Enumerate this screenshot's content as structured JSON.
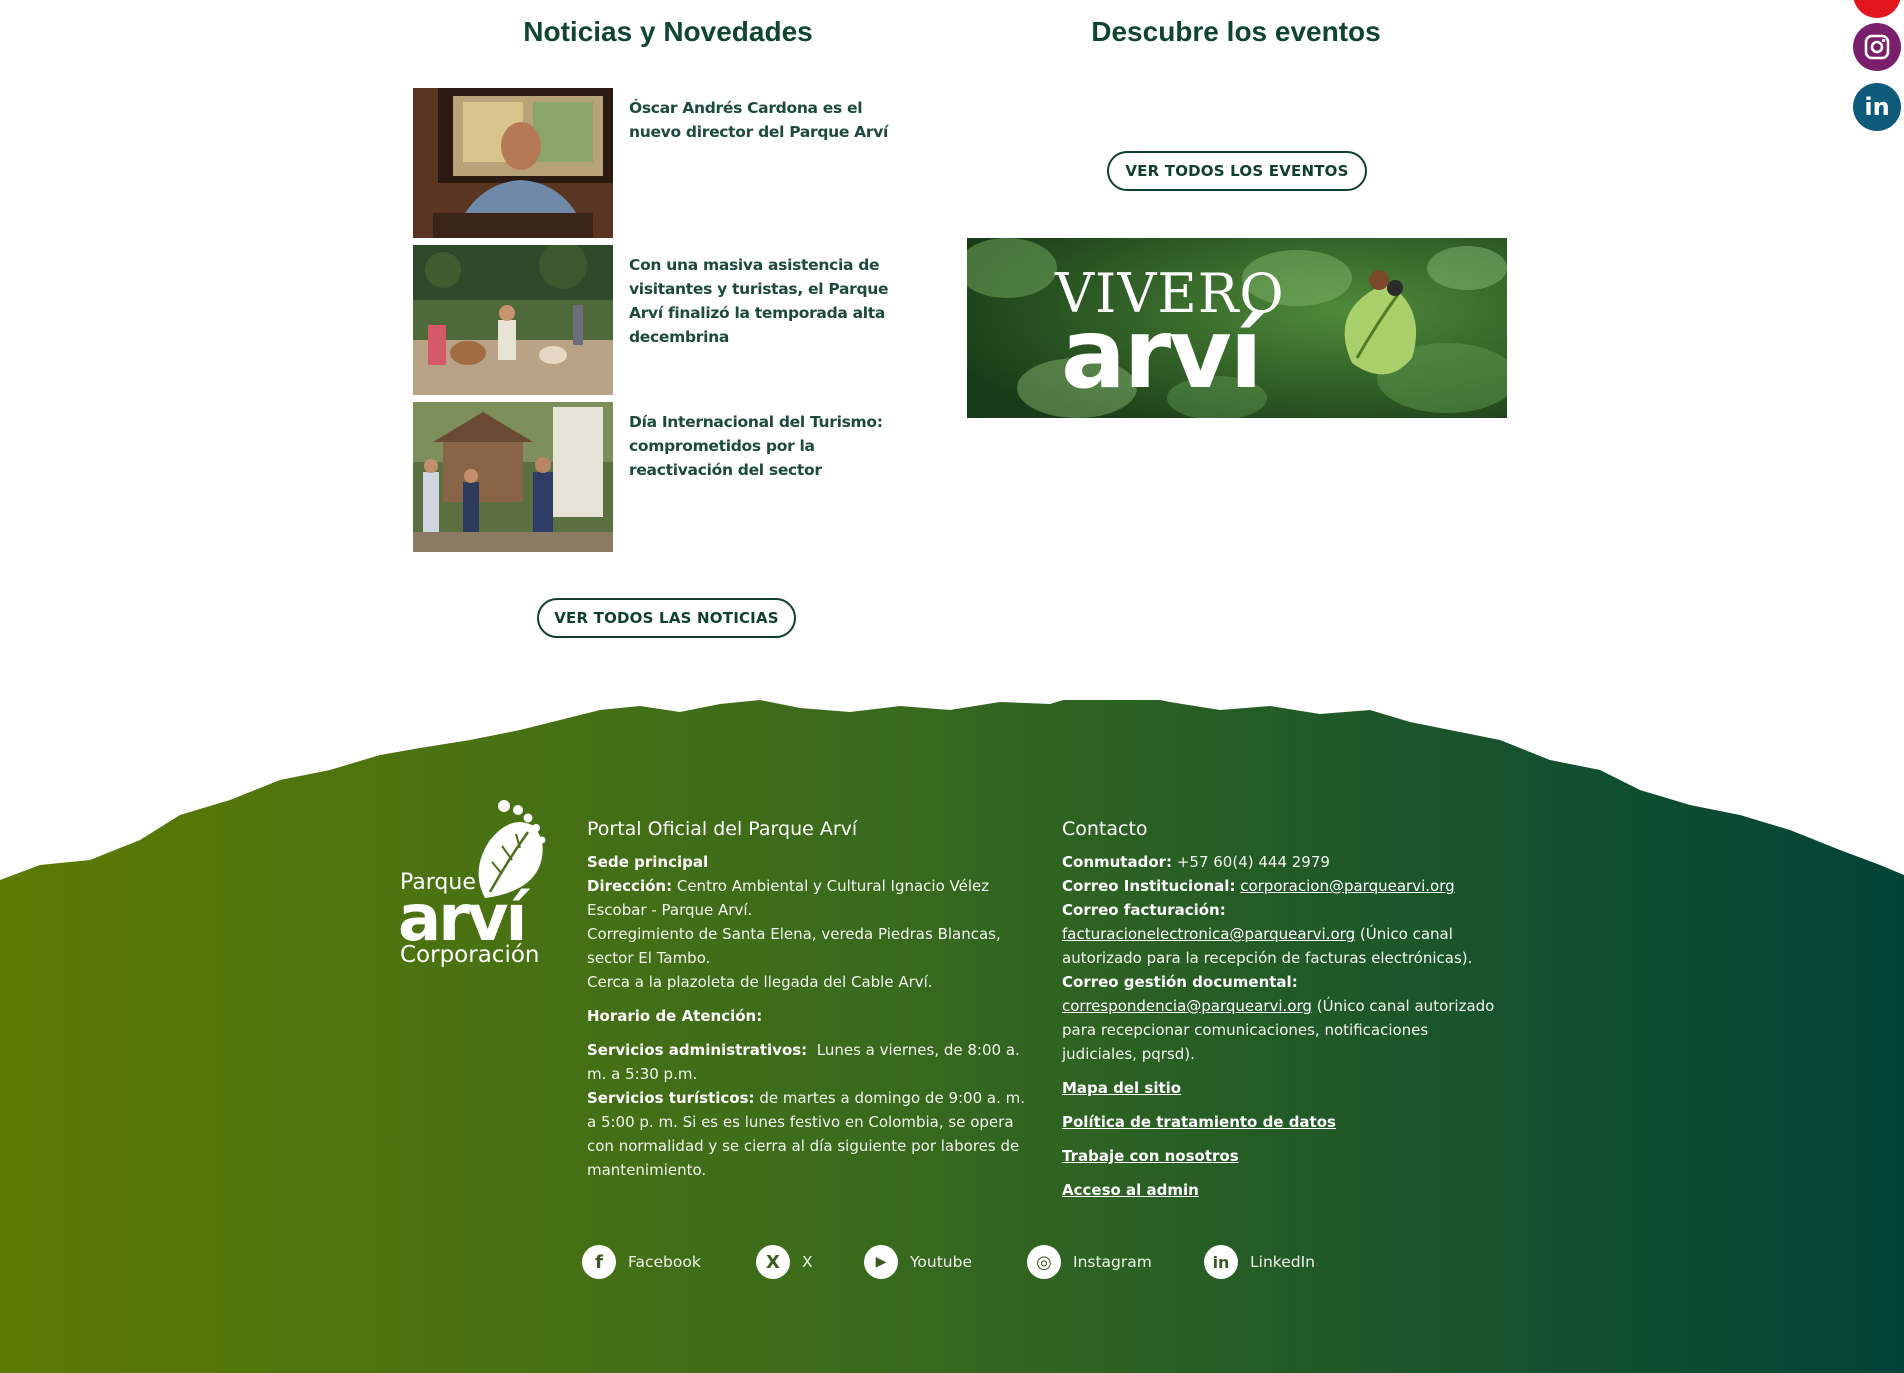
{
  "news": {
    "title": "Noticias y Novedades",
    "items": [
      {
        "headline": "Óscar Andrés Cardona es el nuevo director del Parque Arví"
      },
      {
        "headline": "Con una masiva asistencia de visitantes y turistas, el Parque Arví finalizó la temporada alta decembrina"
      },
      {
        "headline": "Día Internacional del Turismo: comprometidos por la reactivación del sector"
      }
    ],
    "button_label": "VER TODOS LAS NOTICIAS"
  },
  "events": {
    "title": "Descubre los eventos",
    "button_label": "VER TODOS LOS EVENTOS",
    "banner": {
      "line1": "VIVERO",
      "line2": "arví"
    }
  },
  "rail_icons": [
    "youtube-icon",
    "instagram-icon",
    "linkedin-icon"
  ],
  "footer": {
    "logo": {
      "top": "Parque",
      "main": "arví",
      "bottom": "Corporación"
    },
    "portal": {
      "title": "Portal Oficial del Parque Arví",
      "sede_label": "Sede principal",
      "direccion_label": "Dirección:",
      "direccion_value": "Centro Ambiental y Cultural Ignacio Vélez Escobar - Parque Arví.",
      "corregimiento": "Corregimiento de Santa Elena, vereda Piedras Blancas, sector El Tambo.",
      "cerca": "Cerca a la plazoleta de llegada del Cable Arví.",
      "horario_label": "Horario de Atención:",
      "admin_label": "Servicios administrativos:",
      "admin_value": "Lunes a viernes, de 8:00 a. m. a 5:30  p.m.",
      "turisticos_label": "Servicios turísticos:",
      "turisticos_value": "de martes a domingo de 9:00 a. m. a 5:00 p. m. Si es es lunes festivo en Colombia, se opera con normalidad y se cierra al día siguiente por labores de mantenimiento."
    },
    "contacto": {
      "title": "Contacto",
      "conmutador_label": "Conmutador:",
      "conmutador_value": "+57 60(4) 444 2979",
      "institucional_label": "Correo Institucional:",
      "institucional_value": "corporacion@parquearvi.org",
      "facturacion_label": "Correo facturación:",
      "facturacion_value": "facturacionelectronica@parquearvi.org",
      "facturacion_note": "(Único canal autorizado para la recepción de facturas electrónicas).",
      "documental_label": "Correo gestión documental:",
      "documental_value": "correspondencia@parquearvi.org",
      "documental_note": "(Único canal autorizado para recepcionar comunicaciones, notificaciones judiciales, pqrsd).",
      "links": [
        "Mapa del sitio",
        "Política de tratamiento de datos",
        "Trabaje con nosotros",
        "Acceso al admin"
      ]
    },
    "social": [
      {
        "label": "Facebook",
        "glyph": "f"
      },
      {
        "label": "X",
        "glyph": "X"
      },
      {
        "label": "Youtube",
        "glyph": "▶"
      },
      {
        "label": "Instagram",
        "glyph": "◎"
      },
      {
        "label": "LinkedIn",
        "glyph": "in"
      }
    ],
    "colors": {
      "left": "#5c7a05",
      "right": "#014337"
    }
  }
}
